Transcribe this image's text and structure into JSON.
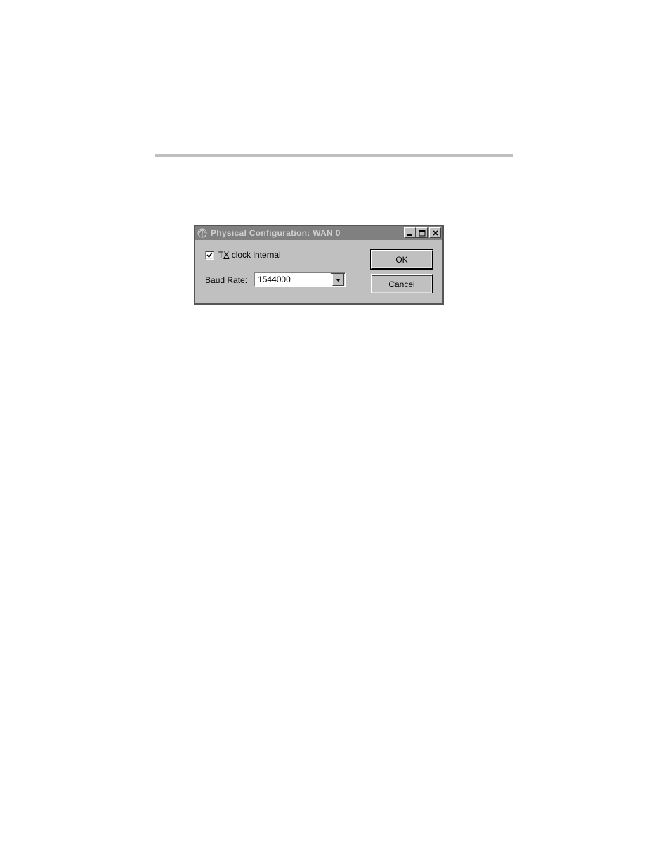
{
  "dialog": {
    "title": "Physical Configuration: WAN 0",
    "tx_clock_label_prefix": "T",
    "tx_clock_label_underlined": "X",
    "tx_clock_label_suffix": " clock internal",
    "tx_clock_checked": true,
    "baud_label_underlined": "B",
    "baud_label_suffix": "aud Rate:",
    "baud_value": "1544000",
    "ok_label": "OK",
    "cancel_label": "Cancel"
  }
}
